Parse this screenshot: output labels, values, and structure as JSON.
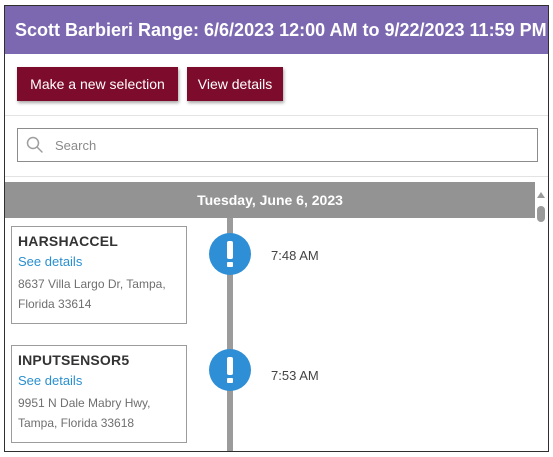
{
  "header": {
    "title": "Scott Barbieri Range: 6/6/2023 12:00 AM to 9/22/2023 11:59 PM"
  },
  "toolbar": {
    "new_selection_label": "Make a new selection",
    "view_details_label": "View details"
  },
  "search": {
    "placeholder": "Search",
    "value": ""
  },
  "timeline": {
    "date_header": "Tuesday, June 6, 2023",
    "events": [
      {
        "title": "HARSHACCEL",
        "link": "See details",
        "address_line1": "8637 Villa Largo Dr, Tampa,",
        "address_line2": "Florida 33614",
        "time": "7:48 AM",
        "icon": "alert-exclamation-icon"
      },
      {
        "title": "INPUTSENSOR5",
        "link": "See details",
        "address_line1": "9951 N Dale Mabry Hwy,",
        "address_line2": "Tampa, Florida 33618",
        "time": "7:53 AM",
        "icon": "alert-exclamation-icon"
      }
    ]
  },
  "colors": {
    "title_bar": "#7b68b0",
    "button": "#7d0c2c",
    "date_header": "#939393",
    "alert_icon": "#2f8fd6",
    "link": "#2a8fd0"
  }
}
